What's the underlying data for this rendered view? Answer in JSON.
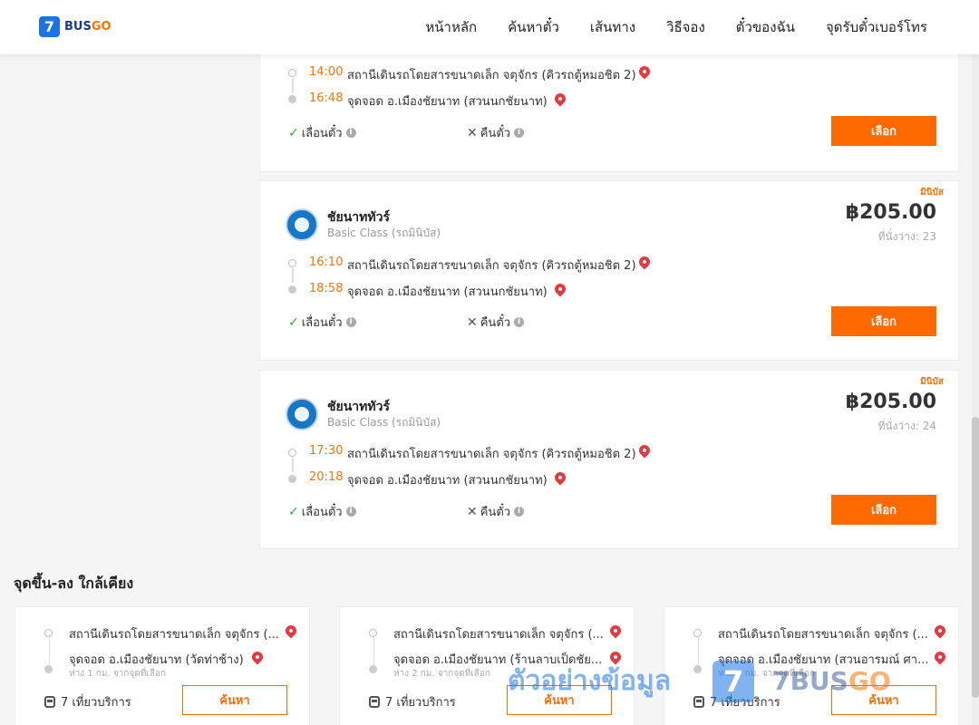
{
  "header": {
    "logo_badge": "7",
    "logo_text": "BUS",
    "logo_go": "GO",
    "nav": [
      "หน้าหลัก",
      "ค้นหาตั๋ว",
      "เส้นทาง",
      "วิธีจอง",
      "ตั๋วของฉัน",
      "จุดรับตั๋วเบอร์โทร"
    ]
  },
  "trips": [
    {
      "tag": "",
      "operator": "",
      "class": "",
      "price": "",
      "seats": "",
      "depart_time": "14:00",
      "depart_stop": "สถานีเดินรถโดยสารขนาดเล็ก จตุจักร (คิวรถตู้หมอชิต 2)",
      "arrive_time": "16:48",
      "arrive_stop": "จุดจอด อ.เมืองชัยนาท (สวนนกชัยนาท)",
      "reschedule": "เลื่อนตั๋ว",
      "refund": "คืนตั๋ว",
      "select": "เลือก"
    },
    {
      "tag": "มินิบัส",
      "operator": "ชัยนาททัวร์",
      "class": "Basic Class (รถมินิบัส)",
      "price": "฿205.00",
      "seats": "ที่นั่งว่าง: 23",
      "depart_time": "16:10",
      "depart_stop": "สถานีเดินรถโดยสารขนาดเล็ก จตุจักร (คิวรถตู้หมอชิต 2)",
      "arrive_time": "18:58",
      "arrive_stop": "จุดจอด อ.เมืองชัยนาท (สวนนกชัยนาท)",
      "reschedule": "เลื่อนตั๋ว",
      "refund": "คืนตั๋ว",
      "select": "เลือก"
    },
    {
      "tag": "มินิบัส",
      "operator": "ชัยนาททัวร์",
      "class": "Basic Class (รถมินิบัส)",
      "price": "฿205.00",
      "seats": "ที่นั่งว่าง: 24",
      "depart_time": "17:30",
      "depart_stop": "สถานีเดินรถโดยสารขนาดเล็ก จตุจักร (คิวรถตู้หมอชิต 2)",
      "arrive_time": "20:18",
      "arrive_stop": "จุดจอด อ.เมืองชัยนาท (สวนนกชัยนาท)",
      "reschedule": "เลื่อนตั๋ว",
      "refund": "คืนตั๋ว",
      "select": "เลือก"
    }
  ],
  "nearby": {
    "title": "จุดขึ้น-ลง ใกล้เคียง",
    "items": [
      {
        "from": "สถานีเดินรถโดยสารขนาดเล็ก จตุจักร (...",
        "to": "จุดจอด อ.เมืองชัยนาท (วัดท่าช้าง)",
        "distance": "ห่าง 1 กม. จากจุดที่เลือก",
        "trips": "7 เที่ยวบริการ",
        "search": "ค้นหา"
      },
      {
        "from": "สถานีเดินรถโดยสารขนาดเล็ก จตุจักร (...",
        "to": "จุดจอด อ.เมืองชัยนาท (ร้านลาบเป็ดชัย...",
        "distance": "ห่าง 2 กม. จากจุดที่เลือก",
        "trips": "7 เที่ยวบริการ",
        "search": "ค้นหา"
      },
      {
        "from": "สถานีเดินรถโดยสารขนาดเล็ก จตุจักร (...",
        "to": "จุดจอด อ.เมืองชัยนาท (สวนอารมณ์ ศา...",
        "distance": "ห่าง 2 กม. จากจุดที่เลือก",
        "trips": "7 เที่ยวบริการ",
        "search": "ค้นหา"
      }
    ]
  },
  "watermark": {
    "text": "ตัวอย่างข้อมูล",
    "badge": "7",
    "brand": "7BUS",
    "brand_go": "GO"
  },
  "colors": {
    "accent": "#ff6a00",
    "brand_blue": "#1a73e8",
    "pin": "#e8383d",
    "check": "#2eaa3c"
  }
}
